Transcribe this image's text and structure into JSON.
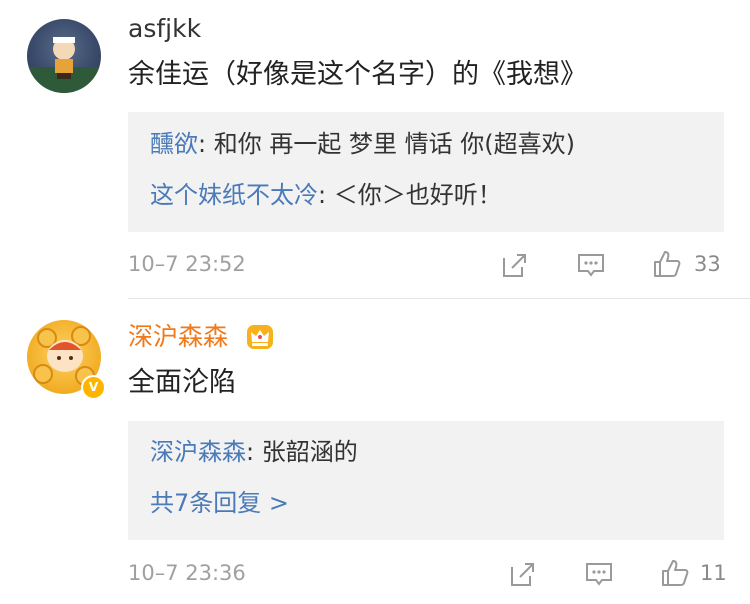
{
  "comments": [
    {
      "username": "asfjkk",
      "text": "余佳运（好像是这个名字）的《我想》",
      "replies": [
        {
          "name": "醺欲",
          "text": "和你 再一起 梦里 情话 你(超喜欢)"
        },
        {
          "name": "这个妹纸不太冷",
          "text": "＜你＞也好听！"
        }
      ],
      "time": "10–7 23:52",
      "likes": "33"
    },
    {
      "username": "深沪森森",
      "text": "全面沦陷",
      "replies": [
        {
          "name": "深沪森森",
          "text": "张韶涵的"
        }
      ],
      "more_replies": "共7条回复 >",
      "time": "10–7 23:36",
      "likes": "11"
    }
  ],
  "icons": {
    "share": "share-icon",
    "comment": "comment-icon",
    "like": "like-icon",
    "crown": "crown-badge-icon",
    "verified": "verified-badge-icon"
  },
  "colors": {
    "link": "#4a7ab8",
    "vip_name": "#f07a1a",
    "reply_bg": "#f2f2f2",
    "meta": "#a0a0a0"
  }
}
